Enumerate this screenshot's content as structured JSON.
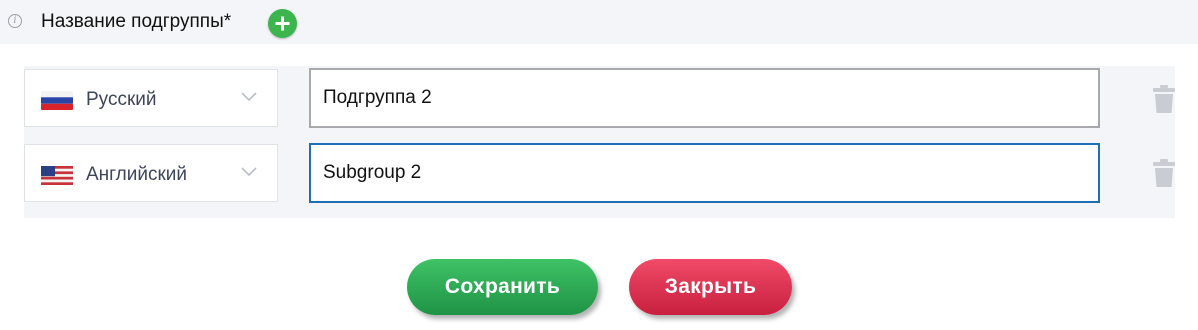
{
  "header": {
    "title": "Название подгруппы*"
  },
  "rows": [
    {
      "language": "Русский",
      "flag": "russia-flag",
      "value": "Подгруппа 2",
      "focused": false
    },
    {
      "language": "Английский",
      "flag": "usa-flag",
      "value": "Subgroup 2",
      "focused": true
    }
  ],
  "buttons": {
    "save_label": "Сохранить",
    "close_label": "Закрыть"
  },
  "colors": {
    "save": "#2dae55",
    "close": "#e33655",
    "add": "#3cb54e",
    "focus_border": "#1f6fb5"
  }
}
